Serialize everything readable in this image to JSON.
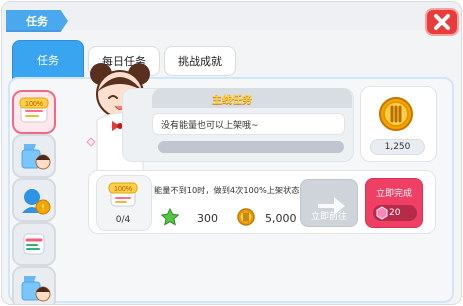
{
  "window": {
    "title": "任务"
  },
  "tabs": [
    {
      "label": "任务",
      "active": true
    },
    {
      "label": "每日任务",
      "active": false
    },
    {
      "label": "挑战成就",
      "active": false
    }
  ],
  "main_task": {
    "title": "主线任务",
    "description": "没有能量也可以上架哦~",
    "reward_value": "1,250"
  },
  "sub_task": {
    "description": "能量不到10时，做到4次100%上架状态",
    "progress": "0/4",
    "rewards": [
      {
        "icon": "star-icon",
        "value": "300"
      },
      {
        "icon": "coin-icon",
        "value": "5,000"
      }
    ],
    "goto_button_label": "立即前往",
    "complete_button_label": "立即完成",
    "complete_cost": "20"
  },
  "left_list": [
    {
      "icon": "100-percent-badge-icon",
      "selected": true
    },
    {
      "icon": "character-flag-icon",
      "selected": false
    },
    {
      "icon": "person-coin-icon",
      "selected": false
    },
    {
      "icon": "notepad-icon",
      "selected": false
    },
    {
      "icon": "character-flag-icon",
      "selected": false
    }
  ],
  "colors": {
    "accent_blue": "#39a4ef",
    "close_red": "#ea3b3b",
    "complete_pink": "#ef3f64"
  }
}
